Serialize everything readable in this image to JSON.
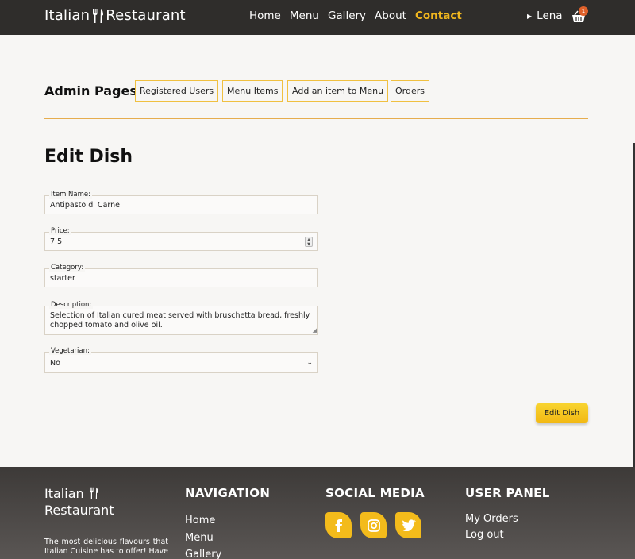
{
  "header": {
    "brand": "Italian Restaurant",
    "nav": [
      "Home",
      "Menu",
      "Gallery",
      "About",
      "Contact"
    ],
    "active_nav": "Contact",
    "user_name": "Lena",
    "cart_count": "1"
  },
  "admin": {
    "title": "Admin Pages",
    "buttons": [
      "Registered Users",
      "Menu Items",
      "Add an item to Menu",
      "Orders"
    ]
  },
  "form": {
    "title": "Edit Dish",
    "item_name": {
      "label": "Item Name:",
      "value": "Antipasto di Carne"
    },
    "price": {
      "label": "Price:",
      "value": "7.5"
    },
    "category": {
      "label": "Category:",
      "value": "starter"
    },
    "description": {
      "label": "Description:",
      "value": "Selection of Italian cured meat served with bruschetta bread, freshly chopped tomato and olive oil."
    },
    "vegetarian": {
      "label": "Vegetarian:",
      "value": "No"
    },
    "submit_label": "Edit Dish"
  },
  "footer": {
    "brand_line1": "Italian",
    "brand_line2": "Restaurant",
    "tagline": "The most delicious flavours that Italian Cuisine has to offer! Have",
    "nav_heading": "NAVIGATION",
    "nav_links": [
      "Home",
      "Menu",
      "Gallery"
    ],
    "social_heading": "SOCIAL MEDIA",
    "social_icons": [
      "facebook-icon",
      "instagram-icon",
      "twitter-icon"
    ],
    "user_heading": "USER PANEL",
    "user_links": [
      "My Orders",
      "Log out"
    ]
  },
  "colors": {
    "accent": "#f0b61e",
    "topbar": "#2f2d2b",
    "badge": "#e0612a",
    "divider": "#e6ad4e"
  }
}
